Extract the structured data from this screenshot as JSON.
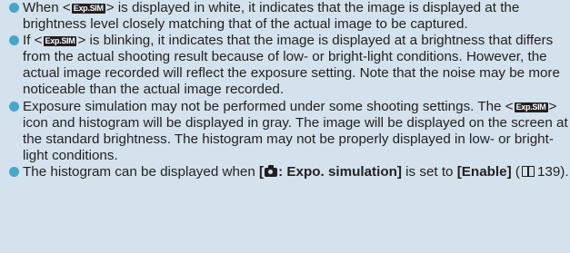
{
  "icons": {
    "exp_sim": "Exp.SIM"
  },
  "items": [
    {
      "text_1": "When <",
      "text_2": "> is displayed in white, it indicates that the image is displayed at the brightness level closely matching that of the actual image to be captured."
    },
    {
      "text_1": "If <",
      "text_2": "> is blinking, it indicates that the image is displayed at a brightness that differs from the actual shooting result because of low- or bright-light conditions. However, the actual image recorded will reflect the exposure setting. Note that the noise may be more noticeable than the actual image recorded."
    },
    {
      "text_1": "Exposure simulation may not be performed under some shooting settings. The <",
      "text_2": "> icon and histogram will be displayed in gray. The image will be displayed on the screen at the standard brightness. The histogram may not be properly displayed in low- or bright-light conditions."
    },
    {
      "text_1": "The histogram can be displayed when ",
      "bold_1_open": "[",
      "bold_1_rest": ": Expo. simulation]",
      "text_2": " is set to ",
      "bold_2": "[Enable]",
      "text_3": " (",
      "page_ref": "139",
      "text_4": ")."
    }
  ],
  "colors": {
    "background": "#d3e2ec",
    "bullet": "#49a6c9",
    "text": "#231f20",
    "icon_bg": "#231f20",
    "icon_fg": "#ffffff"
  }
}
